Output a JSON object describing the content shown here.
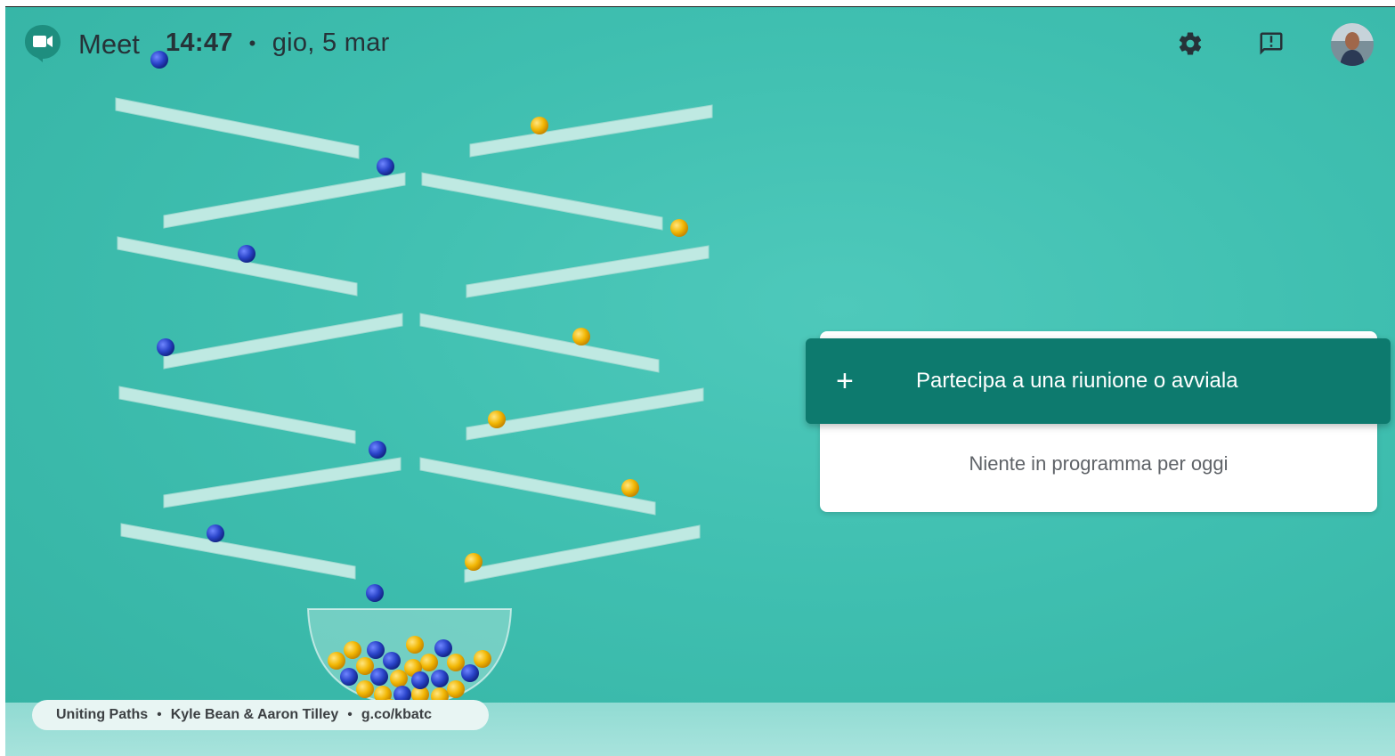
{
  "header": {
    "app_name": "Meet",
    "time": "14:47",
    "separator": "•",
    "date": "gio, 5 mar"
  },
  "icons": {
    "logo": "meet-logo-icon",
    "settings": "gear-icon",
    "feedback": "feedback-icon",
    "avatar": "user-avatar"
  },
  "main": {
    "join_button_icon": "+",
    "join_button_label": "Partecipa a una riunione o avviala",
    "empty_schedule_text": "Niente in programma per oggi"
  },
  "footer": {
    "credit_title": "Uniting Paths",
    "credit_sep": "•",
    "credit_authors": "Kyle Bean & Aaron Tilley",
    "credit_link": "g.co/kbatc"
  },
  "colors": {
    "background": "#3fbfb0",
    "join_button": "#0d7a6e",
    "blue_ball": "#2a44c9",
    "yellow_ball": "#f2b705"
  }
}
